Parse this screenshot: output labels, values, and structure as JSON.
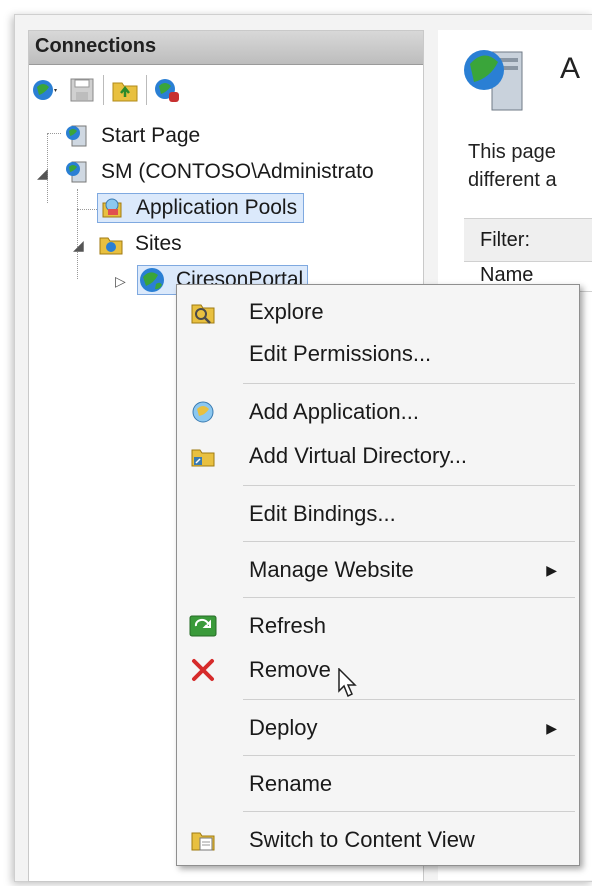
{
  "connections": {
    "header": "Connections",
    "toolbar": [
      "connect-icon",
      "save-icon",
      "up-folder-icon",
      "disconnect-icon"
    ]
  },
  "tree": {
    "start_page": "Start Page",
    "server": "SM (CONTOSO\\Administrato",
    "app_pools": "Application Pools",
    "sites": "Sites",
    "site": "CiresonPortal"
  },
  "right": {
    "title": "A",
    "desc_line1": "This page",
    "desc_line2": "different a",
    "filter": "Filter:",
    "col_name": "Name"
  },
  "menu": {
    "explore": "Explore",
    "edit_permissions": "Edit Permissions...",
    "add_application": "Add Application...",
    "add_virtual_directory": "Add Virtual Directory...",
    "edit_bindings": "Edit Bindings...",
    "manage_website": "Manage Website",
    "refresh": "Refresh",
    "remove": "Remove",
    "deploy": "Deploy",
    "rename": "Rename",
    "switch_content_view": "Switch to Content View"
  },
  "colors": {
    "selection": "#dbe9fb",
    "remove_x": "#d62b2b",
    "refresh_green": "#3a9a3a"
  }
}
